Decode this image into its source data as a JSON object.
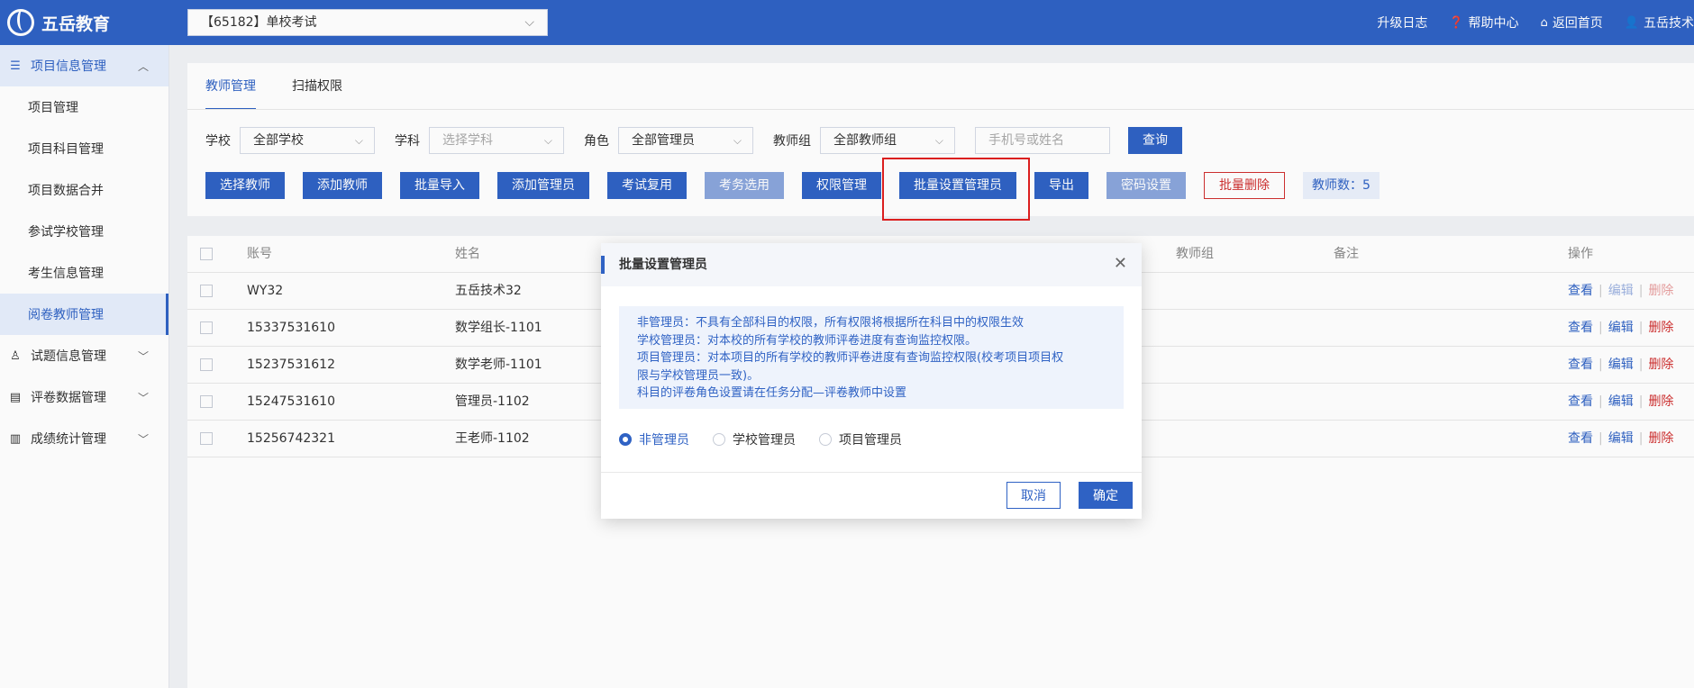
{
  "app": {
    "brand": "五岳教育"
  },
  "header": {
    "exam_select": "【65182】单校考试",
    "links": [
      {
        "label": "升级日志"
      },
      {
        "label": "帮助中心",
        "icon": "help-circle-icon"
      },
      {
        "label": "返回首页",
        "icon": "home-icon"
      },
      {
        "label": "五岳技术",
        "icon": "user-icon"
      }
    ]
  },
  "sidebar": {
    "groups": [
      {
        "label": "项目信息管理",
        "icon": "database-icon",
        "expanded": true,
        "items": [
          "项目管理",
          "项目科目管理",
          "项目数据合并",
          "参试学校管理",
          "考生信息管理",
          "阅卷教师管理"
        ]
      },
      {
        "label": "试题信息管理",
        "icon": "person-icon"
      },
      {
        "label": "评卷数据管理",
        "icon": "table-icon"
      },
      {
        "label": "成绩统计管理",
        "icon": "chart-icon"
      }
    ]
  },
  "tabs": [
    "教师管理",
    "扫描权限"
  ],
  "filters": {
    "school_label": "学校",
    "school_value": "全部学校",
    "subject_label": "学科",
    "subject_placeholder": "选择学科",
    "role_label": "角色",
    "role_value": "全部管理员",
    "group_label": "教师组",
    "group_value": "全部教师组",
    "search_placeholder": "手机号或姓名",
    "query_button": "查询"
  },
  "actions": {
    "select_teacher": "选择教师",
    "add_teacher": "添加教师",
    "batch_import": "批量导入",
    "add_admin": "添加管理员",
    "exam_reuse": "考试复用",
    "exam_select": "考务选用",
    "permission": "权限管理",
    "batch_set_admin": "批量设置管理员",
    "export": "导出",
    "password": "密码设置",
    "batch_delete": "批量删除",
    "teacher_count": "教师数：5"
  },
  "table": {
    "headers": {
      "account": "账号",
      "name": "姓名",
      "group": "教师组",
      "note": "备注",
      "ops": "操作"
    },
    "rows": [
      {
        "account": "WY32",
        "name": "五岳技术32"
      },
      {
        "account": "15337531610",
        "name": "数学组长-1101"
      },
      {
        "account": "15237531612",
        "name": "数学老师-1101"
      },
      {
        "account": "15247531610",
        "name": "管理员-1102"
      },
      {
        "account": "15256742321",
        "name": "王老师-1102"
      }
    ],
    "op_view": "查看",
    "op_edit": "编辑",
    "op_delete": "删除"
  },
  "dialog": {
    "title": "批量设置管理员",
    "info": [
      "非管理员：不具有全部科目的权限，所有权限将根据所在科目中的权限生效",
      "学校管理员：对本校的所有学校的教师评卷进度有查询监控权限。",
      "项目管理员：对本项目的所有学校的教师评卷进度有查询监控权限(校考项目项目权",
      "限与学校管理员一致)。",
      "科目的评卷角色设置请在任务分配—评卷教师中设置"
    ],
    "options": [
      "非管理员",
      "学校管理员",
      "项目管理员"
    ],
    "selected": "非管理员",
    "cancel": "取消",
    "confirm": "确定"
  },
  "colors": {
    "primary": "#2f62c4",
    "danger": "#d03030",
    "highlight": "#e02020"
  }
}
